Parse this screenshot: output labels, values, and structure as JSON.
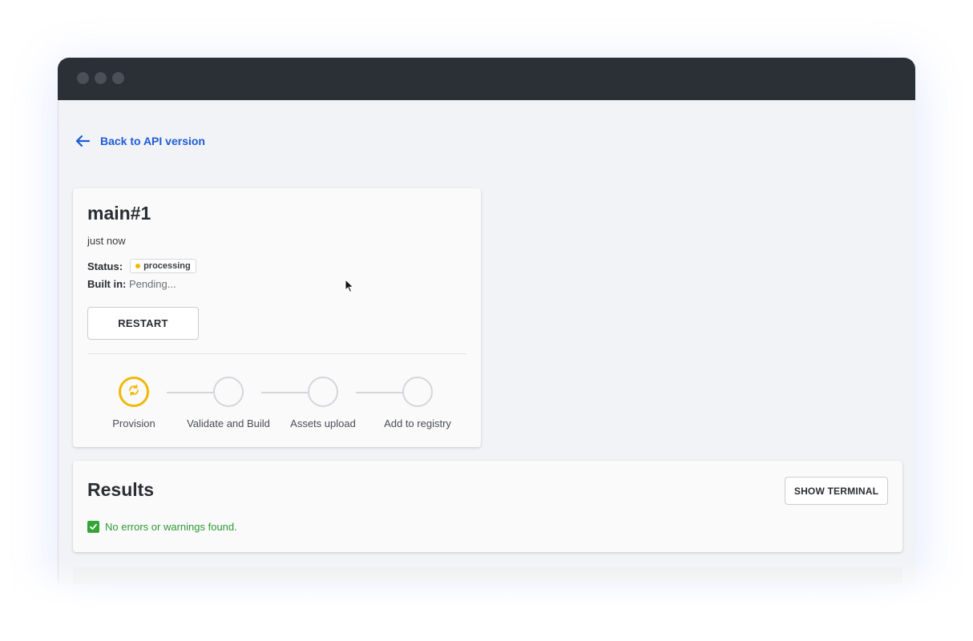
{
  "nav": {
    "back_label": "Back to API version"
  },
  "build": {
    "title": "main#1",
    "time": "just now",
    "status_label": "Status:",
    "status_value": "processing",
    "built_label": "Built in:",
    "built_value": "Pending...",
    "restart_label": "RESTART"
  },
  "steps": [
    {
      "label": "Provision",
      "state": "active"
    },
    {
      "label": "Validate and Build",
      "state": "pending"
    },
    {
      "label": "Assets upload",
      "state": "pending"
    },
    {
      "label": "Add to registry",
      "state": "pending"
    }
  ],
  "results": {
    "title": "Results",
    "terminal_label": "SHOW TERMINAL",
    "message": "No errors or warnings found."
  },
  "colors": {
    "accent": "#1f5bd6",
    "processing": "#f2b705",
    "success": "#33a534",
    "titlebar": "#2b2f36"
  },
  "icons": {
    "back": "arrow-left-icon",
    "progress": "sync-icon",
    "success": "checkbox-check-icon"
  }
}
